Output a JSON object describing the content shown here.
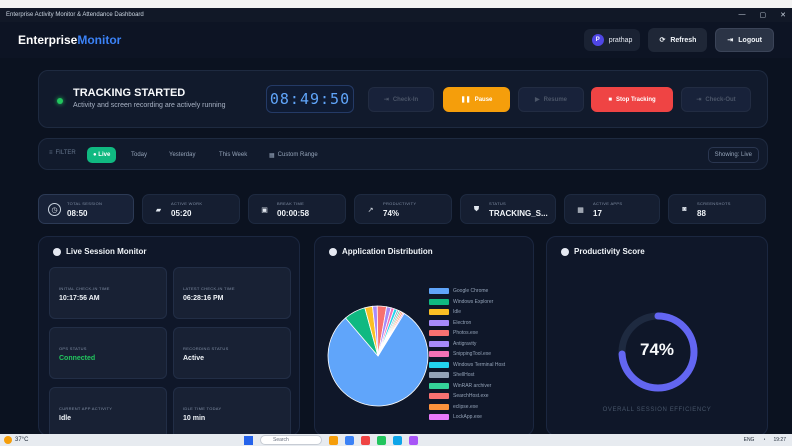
{
  "window": {
    "title": "Enterprise Activity Monitor & Attendance Dashboard",
    "controls": [
      "—",
      "▢",
      "✕"
    ]
  },
  "header": {
    "brand_first": "Enterprise",
    "brand_second": "Monitor",
    "user_initial": "P",
    "user_name": "prathap",
    "refresh_label": "Refresh",
    "logout_label": "Logout"
  },
  "tracking": {
    "title": "TRACKING STARTED",
    "subtitle": "Activity and screen recording are actively running",
    "timer": "08:49:50",
    "checkin_label": "Check-In",
    "pause_label": "Pause",
    "resume_label": "Resume",
    "stop_label": "Stop Tracking",
    "checkout_label": "Check-Out"
  },
  "filter": {
    "label": "FILTER",
    "options": [
      "● Live",
      "Today",
      "Yesterday",
      "This Week",
      "Custom Range"
    ],
    "active_index": 0,
    "showing": "Showing: Live"
  },
  "stats": [
    {
      "label": "TOTAL SESSION",
      "value": "08:50",
      "icon": "clock-icon",
      "icon_color": "#334155"
    },
    {
      "label": "ACTIVE WORK",
      "value": "05:20",
      "icon": "briefcase-icon",
      "icon_color": "#16a34a"
    },
    {
      "label": "BREAK TIME",
      "value": "00:00:58",
      "icon": "coffee-icon",
      "icon_color": "#a16207"
    },
    {
      "label": "PRODUCTIVITY",
      "value": "74%",
      "icon": "trend-up-icon",
      "icon_color": "#0f766e"
    },
    {
      "label": "STATUS",
      "value": "TRACKING_S...",
      "icon": "shield-icon",
      "icon_color": "#15803d"
    },
    {
      "label": "ACTIVE APPS",
      "value": "17",
      "icon": "grid-icon",
      "icon_color": "#4338ca"
    },
    {
      "label": "SCREENSHOTS",
      "value": "88",
      "icon": "camera-icon",
      "icon_color": "#334155"
    }
  ],
  "live_session": {
    "title": "Live Session Monitor",
    "cards": [
      {
        "label": "INITIAL CHECK-IN TIME",
        "value": "10:17:56 AM"
      },
      {
        "label": "LATEST CHECK-IN TIME",
        "value": "06:28:16 PM"
      },
      {
        "label": "OPS STATUS",
        "value": "Connected"
      },
      {
        "label": "RECORDING STATUS",
        "value": "Active"
      },
      {
        "label": "CURRENT APP ACTIVITY",
        "value": "Idle"
      },
      {
        "label": "IDLE TIME TODAY",
        "value": "10 min"
      }
    ]
  },
  "distribution": {
    "title": "Application Distribution"
  },
  "chart_data": {
    "type": "pie",
    "categories": [
      "Google Chrome",
      "Windows Explorer",
      "Idle",
      "Electron",
      "Photos.exe",
      "Antigravity",
      "SnippingTool.exe",
      "Windows Terminal Host",
      "ShellHost",
      "WinRAR archiver",
      "SearchHost.exe",
      "eclipse.exe",
      "LockApp.exe"
    ],
    "values": [
      80,
      7,
      2.5,
      1.5,
      3,
      1.5,
      1,
      1,
      0.6,
      0.5,
      0.5,
      0.5,
      0.4
    ],
    "colors": [
      "#60a5fa",
      "#10b981",
      "#fbbf24",
      "#a78bfa",
      "#f87171",
      "#a78bfa",
      "#f472b6",
      "#22d3ee",
      "#94a3b8",
      "#34d399",
      "#f87171",
      "#fb923c",
      "#e879f9"
    ]
  },
  "productivity": {
    "title": "Productivity Score",
    "percent": 74,
    "percent_label": "74%",
    "caption": "OVERALL SESSION EFFICIENCY"
  },
  "taskbar": {
    "temp": "37°C",
    "search": "Search",
    "lang": "ENG",
    "time": "19:27"
  }
}
